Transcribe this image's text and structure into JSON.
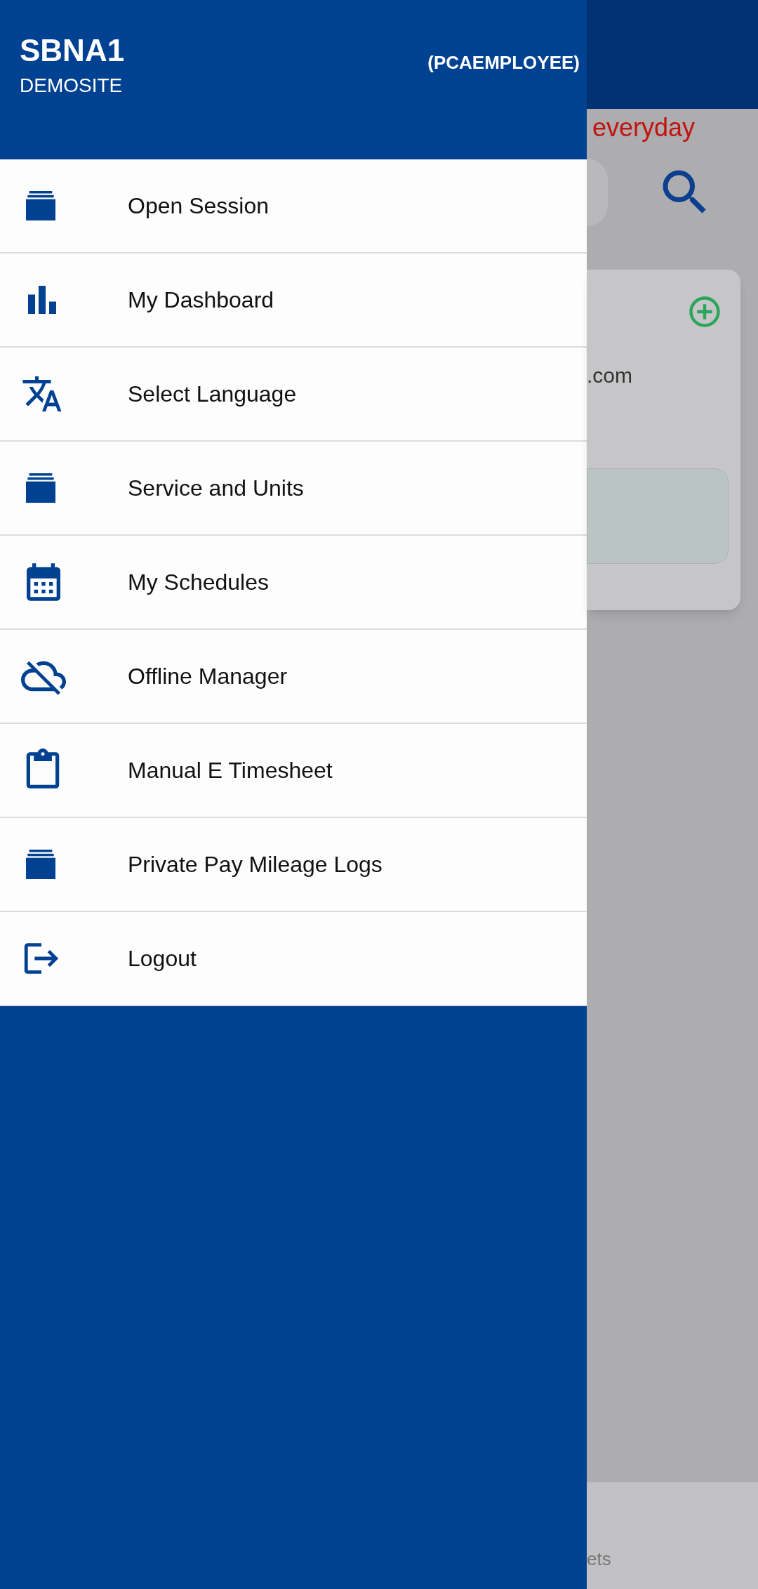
{
  "drawer": {
    "user_name": "SBNA1",
    "site": "DEMOSITE",
    "role": "(PCAEMPLOYEE)",
    "items": [
      {
        "label": "Open Session"
      },
      {
        "label": "My Dashboard"
      },
      {
        "label": "Select Language"
      },
      {
        "label": "Service and Units"
      },
      {
        "label": "My Schedules"
      },
      {
        "label": "Offline Manager"
      },
      {
        "label": "Manual E Timesheet"
      },
      {
        "label": "Private Pay Mileage Logs"
      },
      {
        "label": "Logout"
      }
    ]
  },
  "background": {
    "banner_text": "everyday",
    "card_text": ".com",
    "bottom_tab_text": "ets"
  }
}
